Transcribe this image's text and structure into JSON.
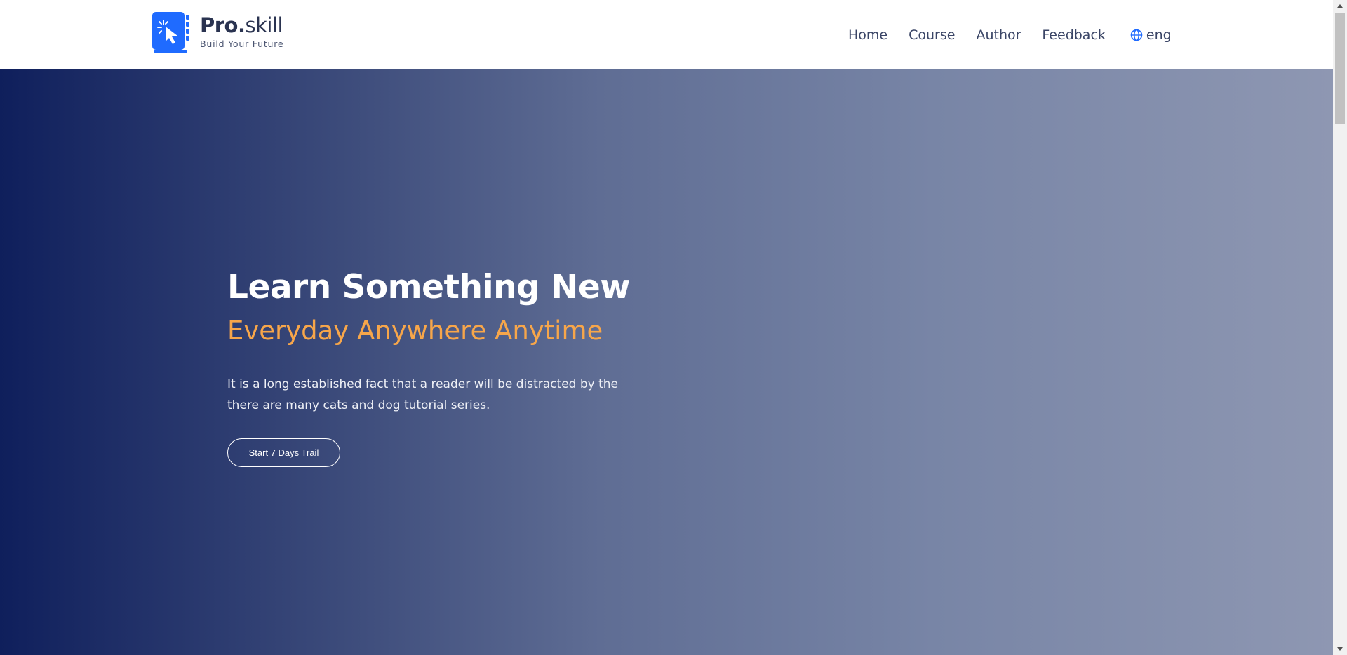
{
  "brand": {
    "title_bold": "Pro.",
    "title_light": "skill",
    "tagline": "Build Your Future",
    "accent_color": "#1f6bff"
  },
  "nav": {
    "items": [
      {
        "label": "Home"
      },
      {
        "label": "Course"
      },
      {
        "label": "Author"
      },
      {
        "label": "Feedback"
      }
    ],
    "language": "eng",
    "language_icon": "globe-icon"
  },
  "hero": {
    "title": "Learn Something New",
    "subtitle": "Everyday Anywhere Anytime",
    "description": "It is a long established fact that a reader will be distracted by the there are many cats and dog tutorial series.",
    "cta_label": "Start 7 Days Trail",
    "subtitle_color": "#f7a64a"
  }
}
